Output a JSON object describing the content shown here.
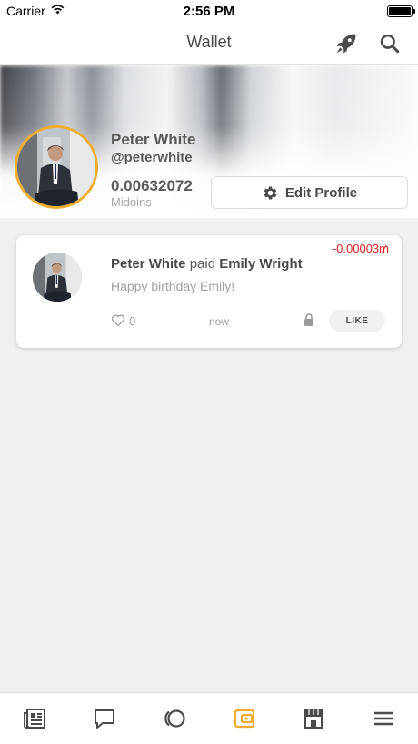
{
  "status_bar": {
    "carrier": "Carrier",
    "time": "2:56 PM",
    "icons": [
      "wifi-icon",
      "battery-icon"
    ]
  },
  "nav": {
    "title": "Wallet",
    "icons": [
      "rocket-icon",
      "search-icon"
    ]
  },
  "profile": {
    "name": "Peter White",
    "handle": "@peterwhite",
    "balance": "0.00632072",
    "balance_unit": "Midoins",
    "edit_label": "Edit Profile",
    "accent_color": "#f0ad2f"
  },
  "feed": [
    {
      "payer": "Peter White",
      "verb": "paid",
      "payee": "Emily Wright",
      "amount": "-0.00003₥",
      "memo": "Happy birthday Emily!",
      "likes": "0",
      "time": "now",
      "like_label": "LIKE",
      "amount_color": "#e02020"
    }
  ],
  "tabs": [
    {
      "name": "news-icon",
      "active": false
    },
    {
      "name": "chat-icon",
      "active": false
    },
    {
      "name": "exchange-icon",
      "active": false
    },
    {
      "name": "wallet-icon",
      "active": true
    },
    {
      "name": "store-icon",
      "active": false
    },
    {
      "name": "menu-icon",
      "active": false
    }
  ],
  "colors": {
    "active_tab": "#f0ad2f",
    "inactive_tab": "#4a4a4a"
  }
}
